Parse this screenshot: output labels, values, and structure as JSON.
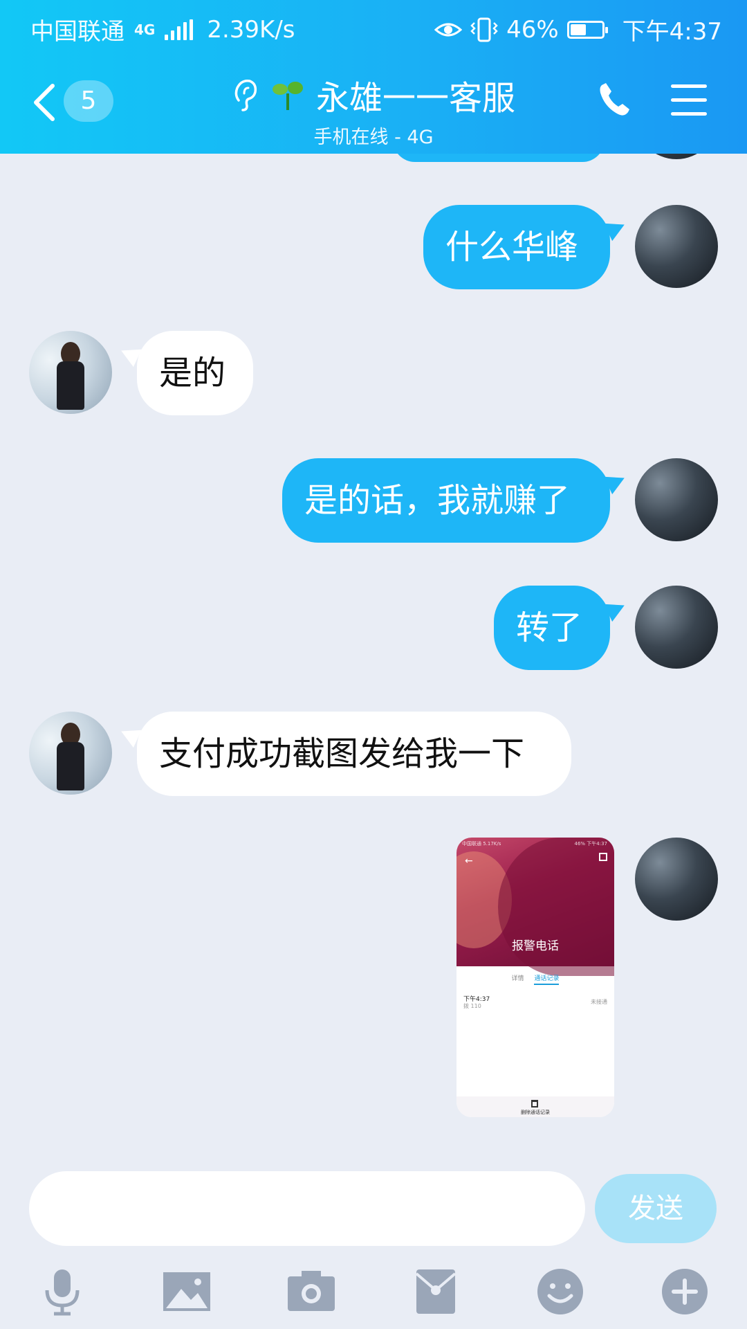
{
  "status_bar": {
    "carrier": "中国联通",
    "network_type": "4G",
    "speed": "2.39K/s",
    "battery": "46%",
    "battery_level": 0.46,
    "time": "下午4:37"
  },
  "header": {
    "unread_count": "5",
    "title": "永雄一一客服",
    "subtitle": "手机在线 - 4G"
  },
  "messages": [
    {
      "sender": "me",
      "text": "什么华峰"
    },
    {
      "sender": "cs",
      "text": "是的"
    },
    {
      "sender": "me",
      "text": "是的话，我就赚了"
    },
    {
      "sender": "me",
      "text": "转了"
    },
    {
      "sender": "cs",
      "text": "支付成功截图发给我一下"
    }
  ],
  "image_message": {
    "sender": "me",
    "status_text": "中国联通 5.17K/s",
    "status_right": "46% 下午4:37",
    "title": "报警电话",
    "tabs": [
      "详情",
      "通话记录"
    ],
    "call_time": "下午4:37",
    "call_number": "拨 110",
    "call_status": "未接通",
    "bottom_action": "删除通话记录"
  },
  "input": {
    "value": "",
    "send_label": "发送"
  },
  "toolbar_icons": [
    "microphone-icon",
    "image-icon",
    "camera-icon",
    "red-packet-icon",
    "emoji-icon",
    "plus-icon"
  ],
  "colors": {
    "header_gradient_start": "#12c8f6",
    "header_gradient_end": "#1a98f3",
    "outgoing_bubble": "#1eb6f7",
    "incoming_bubble": "#ffffff",
    "chat_background": "#e9edf5",
    "send_button_disabled": "#a8e2f8",
    "toolbar_icon": "#9aa6b8"
  }
}
